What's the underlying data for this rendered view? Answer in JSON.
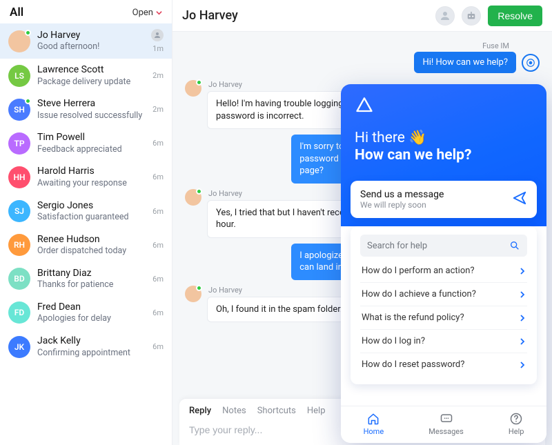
{
  "sidebar": {
    "title": "All",
    "filter_label": "Open"
  },
  "conversations": [
    {
      "initials": "",
      "name": "Jo Harvey",
      "snippet": "Good afternoon!",
      "time": "1m",
      "color": "#f2c5a0",
      "presence": true,
      "selected": true,
      "assignee": true
    },
    {
      "initials": "LS",
      "name": "Lawrence Scott",
      "snippet": "Package delivery update",
      "time": "2m",
      "color": "#75c943",
      "presence": false,
      "selected": false,
      "assignee": false
    },
    {
      "initials": "SH",
      "name": "Steve Herrera",
      "snippet": "Issue resolved successfully",
      "time": "2m",
      "color": "#4a7bff",
      "presence": true,
      "selected": false,
      "assignee": false
    },
    {
      "initials": "TP",
      "name": "Tim Powell",
      "snippet": "Feedback appreciated",
      "time": "6m",
      "color": "#b96bff",
      "presence": false,
      "selected": false,
      "assignee": false
    },
    {
      "initials": "HH",
      "name": "Harold Harris",
      "snippet": "Awaiting your response",
      "time": "6m",
      "color": "#ff4f6e",
      "presence": false,
      "selected": false,
      "assignee": false
    },
    {
      "initials": "SJ",
      "name": "Sergio Jones",
      "snippet": "Satisfaction guaranteed",
      "time": "6m",
      "color": "#3cb6ff",
      "presence": false,
      "selected": false,
      "assignee": false
    },
    {
      "initials": "RH",
      "name": "Renee Hudson",
      "snippet": "Order dispatched today",
      "time": "6m",
      "color": "#ff9a3c",
      "presence": false,
      "selected": false,
      "assignee": false
    },
    {
      "initials": "BD",
      "name": "Brittany Diaz",
      "snippet": "Thanks for patience",
      "time": "6m",
      "color": "#7de0c4",
      "presence": false,
      "selected": false,
      "assignee": false
    },
    {
      "initials": "FD",
      "name": "Fred Dean",
      "snippet": "Apologies for delay",
      "time": "6m",
      "color": "#68e6d6",
      "presence": false,
      "selected": false,
      "assignee": false
    },
    {
      "initials": "JK",
      "name": "Jack Kelly",
      "snippet": "Confirming appointment",
      "time": "6m",
      "color": "#3c7bff",
      "presence": false,
      "selected": false,
      "assignee": false
    }
  ],
  "conversation": {
    "title": "Jo Harvey",
    "resolve_label": "Resolve",
    "bot_name": "Fuse IM",
    "bot_greeting": "Hi! How can we help?",
    "customer_name": "Jo Harvey",
    "msg1": "Hello! I'm having trouble logging into my account. It keeps saying my password is incorrect.",
    "agent1": "I'm sorry to hear that. Have you tried resetting your password using the \"Forgot Password\" link on the login page?",
    "msg2": "Yes, I tried that but I haven't received the reset email. It's been over an hour.",
    "agent2": "I apologize for the inconvenience. Sometimes the email can land in your spam or junk folder.",
    "msg3": "Oh, I found it in the spam folder. Thanks!"
  },
  "reply": {
    "tab_reply": "Reply",
    "tab_notes": "Notes",
    "tab_shortcuts": "Shortcuts",
    "tab_help": "Help",
    "placeholder": "Type your reply..."
  },
  "widget": {
    "hi": "Hi there 👋",
    "headline": "How can we help?",
    "send_title": "Send us a message",
    "send_sub": "We will reply soon",
    "search_placeholder": "Search for help",
    "faqs": [
      "How do I perform an action?",
      "How do I achieve a function?",
      "What is the refund policy?",
      "How do I log in?",
      "How do I reset password?"
    ],
    "nav_home": "Home",
    "nav_messages": "Messages",
    "nav_help": "Help"
  }
}
